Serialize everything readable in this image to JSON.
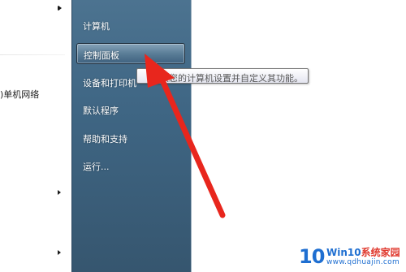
{
  "left_pane": {
    "partial_item": ")单机网络"
  },
  "menu": {
    "items": [
      {
        "label": "计算机"
      },
      {
        "label": "控制面板"
      },
      {
        "label": "设备和打印机"
      },
      {
        "label": "默认程序"
      },
      {
        "label": "帮助和支持"
      },
      {
        "label": "运行..."
      }
    ]
  },
  "tooltip": {
    "text": "改您的计算机设置并自定义其功能。"
  },
  "annotation": {
    "arrow_color": "#e8261d"
  },
  "watermark": {
    "logo": "10",
    "brand_prefix": "Win10",
    "brand_suffix": "系统家园",
    "url": "www.qdhuajin.com"
  },
  "colors": {
    "panel": "#3f6684",
    "highlight": "#5a7d97",
    "tooltip_bg": "#ffffff",
    "arrow": "#e8261d",
    "watermark_blue": "#1f6fd1"
  },
  "icons": [
    "chevron-right-icon",
    "red-arrow-annotation",
    "win10-logo"
  ]
}
